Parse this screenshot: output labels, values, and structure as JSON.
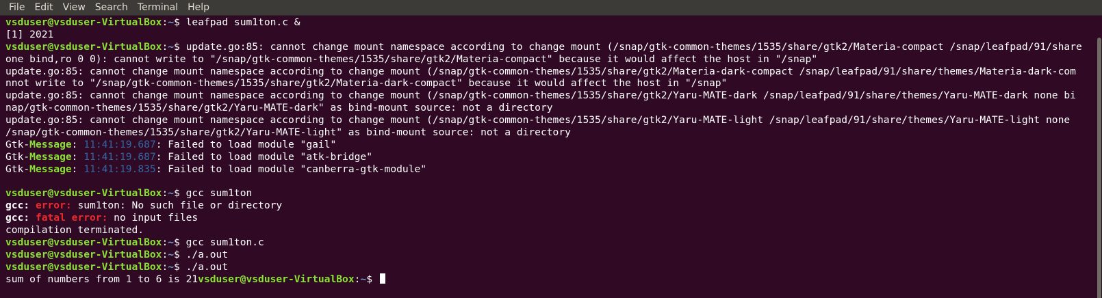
{
  "menu": {
    "items": [
      "File",
      "Edit",
      "View",
      "Search",
      "Terminal",
      "Help"
    ]
  },
  "prompt": {
    "user": "vsduser@vsduser-VirtualBox",
    "sep": ":",
    "path": "~",
    "symbol": "$ "
  },
  "colors": {
    "background": "#300a24",
    "menubar": "#3c3b37",
    "prompt_user": "#8ae234",
    "prompt_path": "#729fcf",
    "error": "#ef2929",
    "timestamp": "#3465a4"
  },
  "lines": [
    {
      "type": "prompt",
      "cmd": "leafpad sum1ton.c &"
    },
    {
      "type": "text",
      "text": "[1] 2021"
    },
    {
      "type": "prompt",
      "cmd": "update.go:85: cannot change mount namespace according to change mount (/snap/gtk-common-themes/1535/share/gtk2/Materia-compact /snap/leafpad/91/share"
    },
    {
      "type": "text",
      "text": "one bind,ro 0 0): cannot write to \"/snap/gtk-common-themes/1535/share/gtk2/Materia-compact\" because it would affect the host in \"/snap\""
    },
    {
      "type": "text",
      "text": "update.go:85: cannot change mount namespace according to change mount (/snap/gtk-common-themes/1535/share/gtk2/Materia-dark-compact /snap/leafpad/91/share/themes/Materia-dark-com"
    },
    {
      "type": "text",
      "text": "nnot write to \"/snap/gtk-common-themes/1535/share/gtk2/Materia-dark-compact\" because it would affect the host in \"/snap\""
    },
    {
      "type": "text",
      "text": "update.go:85: cannot change mount namespace according to change mount (/snap/gtk-common-themes/1535/share/gtk2/Yaru-MATE-dark /snap/leafpad/91/share/themes/Yaru-MATE-dark none bi"
    },
    {
      "type": "text",
      "text": "nap/gtk-common-themes/1535/share/gtk2/Yaru-MATE-dark\" as bind-mount source: not a directory"
    },
    {
      "type": "text",
      "text": "update.go:85: cannot change mount namespace according to change mount (/snap/gtk-common-themes/1535/share/gtk2/Yaru-MATE-light /snap/leafpad/91/share/themes/Yaru-MATE-light none"
    },
    {
      "type": "text",
      "text": "/snap/gtk-common-themes/1535/share/gtk2/Yaru-MATE-light\" as bind-mount source: not a directory"
    },
    {
      "type": "gtk",
      "prefix": "Gtk-",
      "label": "Message",
      "sep": ": ",
      "time": "11:41:19.687",
      "msg": ": Failed to load module \"gail\""
    },
    {
      "type": "gtk",
      "prefix": "Gtk-",
      "label": "Message",
      "sep": ": ",
      "time": "11:41:19.687",
      "msg": ": Failed to load module \"atk-bridge\""
    },
    {
      "type": "gtk",
      "prefix": "Gtk-",
      "label": "Message",
      "sep": ": ",
      "time": "11:41:19.835",
      "msg": ": Failed to load module \"canberra-gtk-module\""
    },
    {
      "type": "text",
      "text": ""
    },
    {
      "type": "prompt",
      "cmd": "gcc sum1ton"
    },
    {
      "type": "gccerr",
      "prog": "gcc:",
      "kind": " error:",
      "msg": " sum1ton: No such file or directory"
    },
    {
      "type": "gccerr",
      "prog": "gcc:",
      "kind": " fatal error:",
      "msg": " no input files"
    },
    {
      "type": "text",
      "text": "compilation terminated."
    },
    {
      "type": "prompt",
      "cmd": "gcc sum1ton.c"
    },
    {
      "type": "prompt",
      "cmd": "./a.out"
    },
    {
      "type": "prompt",
      "cmd": "./a.out"
    },
    {
      "type": "outprompt",
      "out": "sum of numbers from 1 to 6 is 21",
      "cursor": true
    }
  ]
}
